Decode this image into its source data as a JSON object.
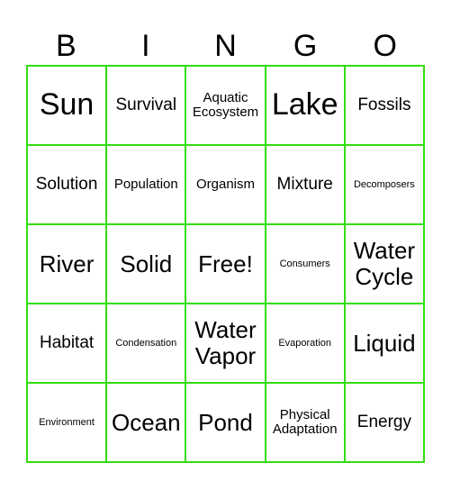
{
  "header": [
    "B",
    "I",
    "N",
    "G",
    "O"
  ],
  "border_color": "#33dd11",
  "cells": [
    "Sun",
    "Survival",
    "Aquatic Ecosystem",
    "Lake",
    "Fossils",
    "Solution",
    "Population",
    "Organism",
    "Mixture",
    "Decomposers",
    "River",
    "Solid",
    "Free!",
    "Consumers",
    "Water Cycle",
    "Habitat",
    "Condensation",
    "Water Vapor",
    "Evaporation",
    "Liquid",
    "Environment",
    "Ocean",
    "Pond",
    "Physical Adaptation",
    "Energy"
  ]
}
